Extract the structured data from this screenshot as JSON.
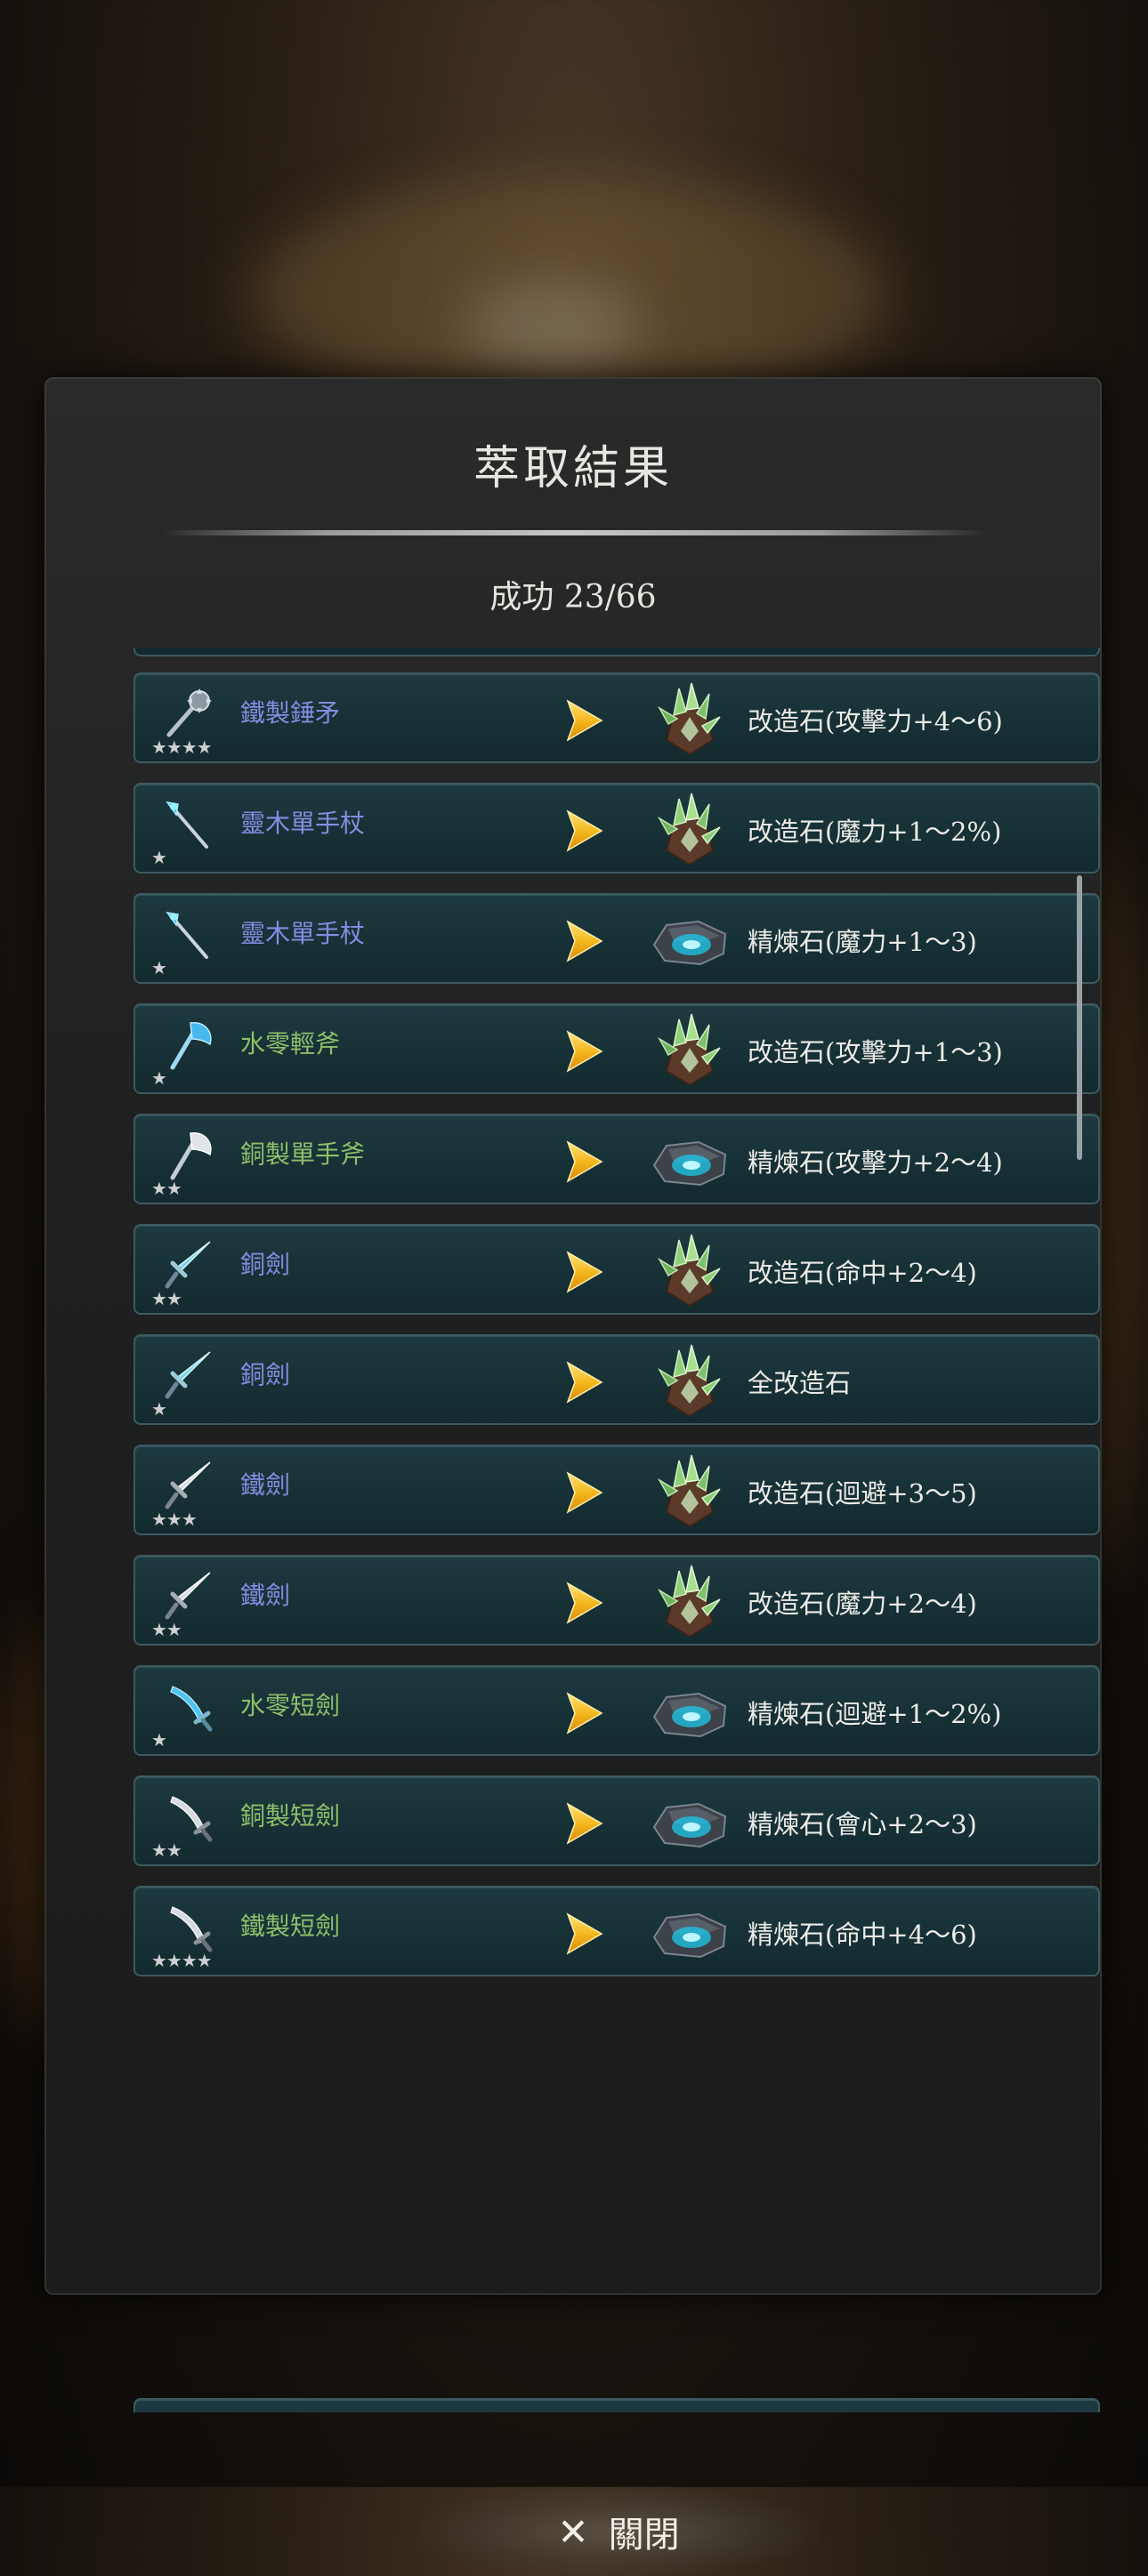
{
  "dialog": {
    "title": "萃取結果",
    "success_text": "成功 23/66",
    "close_label": "關閉"
  },
  "colors": {
    "name_blue": "#7f8fe0",
    "name_green": "#8fbf6a",
    "arrow": "#f4b81e"
  },
  "rows": [
    {
      "name": "鐵製錘矛",
      "name_color": "blue",
      "stars": "★★★★",
      "weapon": "mace-icon",
      "material": "upgrade-stone-icon",
      "result": "改造石(攻擊力+4～6)"
    },
    {
      "name": "靈木單手杖",
      "name_color": "blue",
      "stars": "★",
      "weapon": "staff-icon",
      "material": "upgrade-stone-icon",
      "result": "改造石(魔力+1～2%)"
    },
    {
      "name": "靈木單手杖",
      "name_color": "blue",
      "stars": "★",
      "weapon": "staff-icon",
      "material": "refining-stone-icon",
      "result": "精煉石(魔力+1～3)"
    },
    {
      "name": "水零輕斧",
      "name_color": "green",
      "stars": "★",
      "weapon": "axe-icon",
      "material": "upgrade-stone-icon",
      "result": "改造石(攻擊力+1～3)"
    },
    {
      "name": "銅製單手斧",
      "name_color": "green",
      "stars": "★★",
      "weapon": "axe-icon",
      "material": "refining-stone-icon",
      "result": "精煉石(攻擊力+2～4)"
    },
    {
      "name": "銅劍",
      "name_color": "blue",
      "stars": "★★",
      "weapon": "sword-icon",
      "material": "upgrade-stone-icon",
      "result": "改造石(命中+2～4)"
    },
    {
      "name": "銅劍",
      "name_color": "blue",
      "stars": "★",
      "weapon": "sword-icon",
      "material": "upgrade-stone-icon",
      "result": "全改造石"
    },
    {
      "name": "鐵劍",
      "name_color": "blue",
      "stars": "★★★",
      "weapon": "sword-icon",
      "material": "upgrade-stone-icon",
      "result": "改造石(迴避+3～5)"
    },
    {
      "name": "鐵劍",
      "name_color": "blue",
      "stars": "★★",
      "weapon": "sword-icon",
      "material": "upgrade-stone-icon",
      "result": "改造石(魔力+2～4)"
    },
    {
      "name": "水零短劍",
      "name_color": "green",
      "stars": "★",
      "weapon": "dagger-icon",
      "material": "refining-stone-icon",
      "result": "精煉石(迴避+1～2%)"
    },
    {
      "name": "銅製短劍",
      "name_color": "green",
      "stars": "★★",
      "weapon": "dagger-icon",
      "material": "refining-stone-icon",
      "result": "精煉石(會心+2～3)"
    },
    {
      "name": "鐵製短劍",
      "name_color": "green",
      "stars": "★★★★",
      "weapon": "dagger-icon",
      "material": "refining-stone-icon",
      "result": "精煉石(命中+4～6)"
    }
  ]
}
